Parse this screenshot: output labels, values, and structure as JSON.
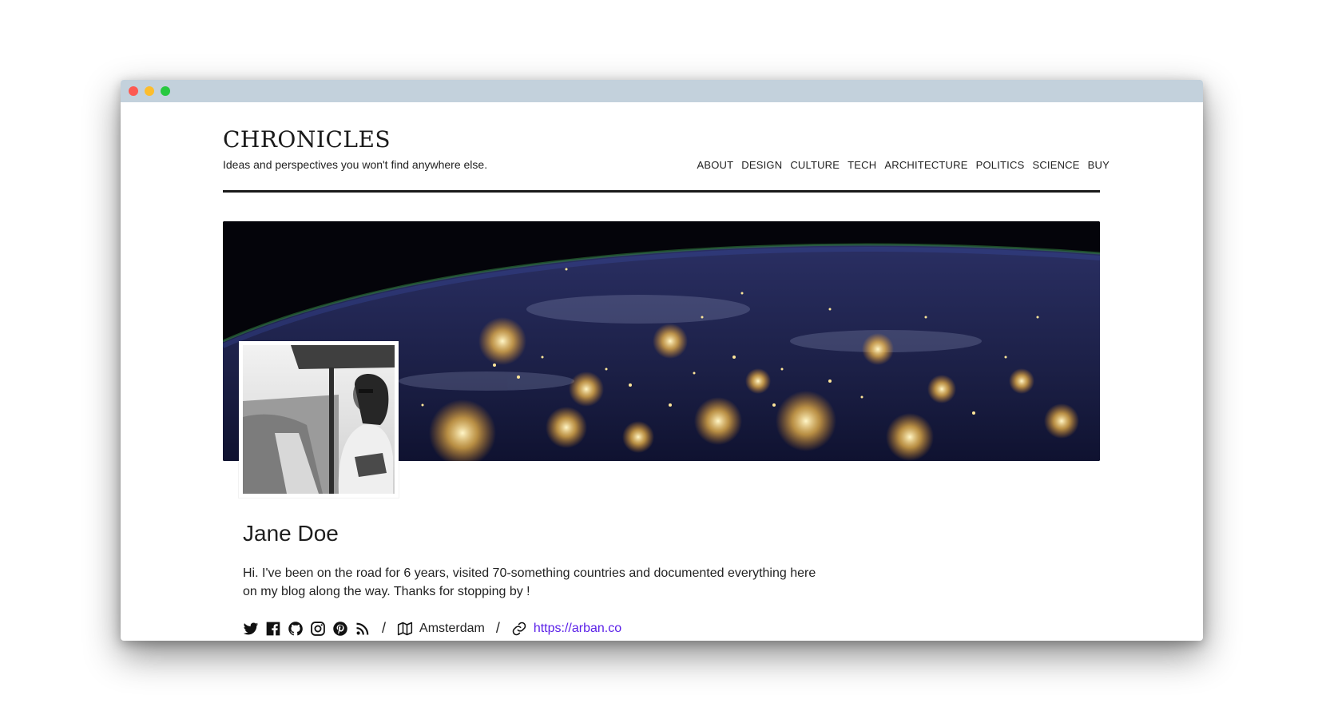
{
  "site": {
    "title": "CHRONICLES",
    "tagline": "Ideas and perspectives you won't find anywhere else."
  },
  "nav": {
    "items": [
      {
        "label": "ABOUT"
      },
      {
        "label": "DESIGN"
      },
      {
        "label": "CULTURE"
      },
      {
        "label": "TECH"
      },
      {
        "label": "ARCHITECTURE"
      },
      {
        "label": "POLITICS"
      },
      {
        "label": "SCIENCE"
      },
      {
        "label": "BUY"
      }
    ]
  },
  "profile": {
    "name": "Jane Doe",
    "bio": "Hi. I've been on the road for 6 years, visited 70-something countries and documented everything here on my blog along the way. Thanks for stopping by !",
    "location": "Amsterdam",
    "website": "https://arban.co",
    "social_icons": [
      "twitter-icon",
      "facebook-icon",
      "github-icon",
      "instagram-icon",
      "pinterest-icon",
      "rss-icon"
    ]
  },
  "colors": {
    "link": "#5b20e8",
    "rule": "#1a1a1a",
    "titlebar": "#c3d1dc"
  }
}
